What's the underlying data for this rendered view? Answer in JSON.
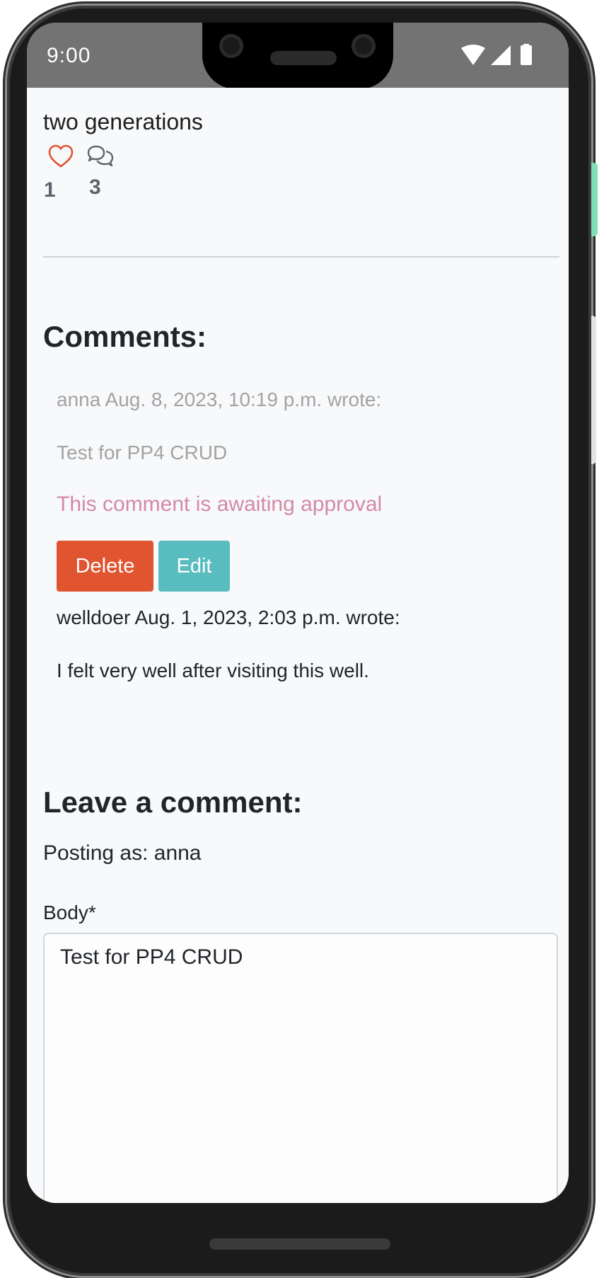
{
  "status_bar": {
    "time": "9:00"
  },
  "post": {
    "text_tail": "two generations",
    "like_count": "1",
    "comment_count": "3",
    "icons": {
      "like": "heart-outline-icon",
      "comments": "chat-bubbles-icon"
    }
  },
  "comments_section": {
    "title": "Comments:",
    "comments": [
      {
        "meta": "anna Aug. 8, 2023, 10:19 p.m. wrote:",
        "body": "Test for PP4 CRUD",
        "status": "This comment is awaiting approval",
        "actions": {
          "delete_label": "Delete",
          "edit_label": "Edit"
        }
      },
      {
        "meta": "welldoer Aug. 1, 2023, 2:03 p.m. wrote:",
        "body": "I felt very well after visiting this well."
      }
    ]
  },
  "comment_form": {
    "title": "Leave a comment:",
    "posting_as": "Posting as: anna",
    "body_label": "Body*",
    "body_value": "Test for PP4 CRUD"
  },
  "colors": {
    "like_icon": "#e0542f",
    "delete_button": "#e0542f",
    "edit_button": "#59bcbf",
    "awaiting_text": "#d48aa4",
    "status_bar": "#737373"
  }
}
